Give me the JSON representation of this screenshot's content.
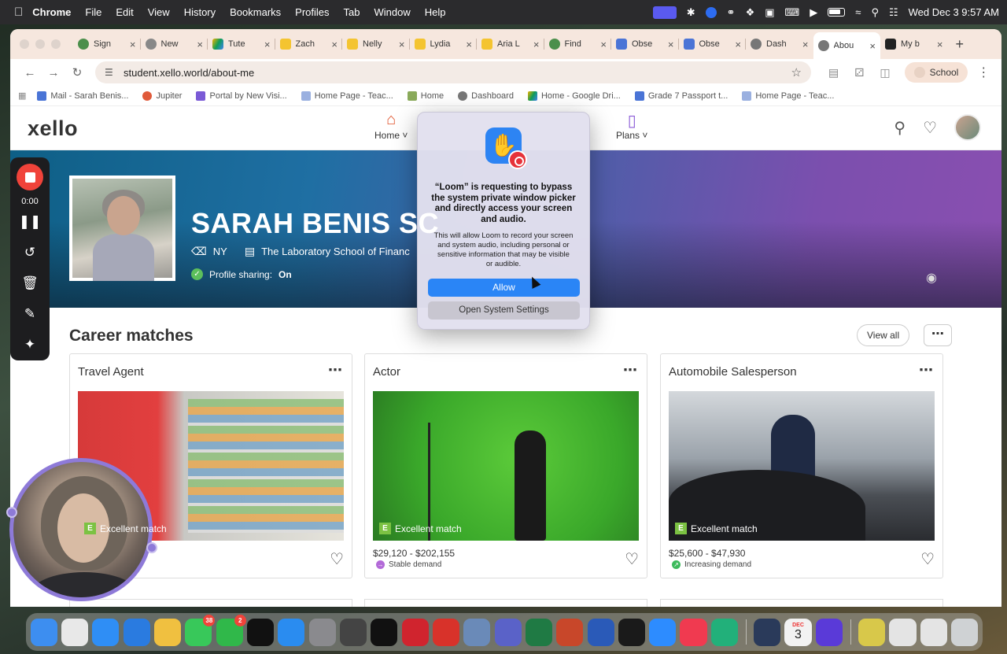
{
  "menubar": {
    "app": "Chrome",
    "items": [
      "File",
      "Edit",
      "View",
      "History",
      "Bookmarks",
      "Profiles",
      "Tab",
      "Window",
      "Help"
    ],
    "clock": "Wed Dec 3  9:57 AM"
  },
  "tabs": [
    {
      "label": "Sign",
      "color": "#4b8f4b"
    },
    {
      "label": "New",
      "color": "#666666"
    },
    {
      "label": "Tute",
      "color": "#f4b400"
    },
    {
      "label": "Zach",
      "color": "#f4c430"
    },
    {
      "label": "Nelly",
      "color": "#f4c430"
    },
    {
      "label": "Lydia",
      "color": "#f4c430"
    },
    {
      "label": "Aria L",
      "color": "#f4c430"
    },
    {
      "label": "Find",
      "color": "#4b8f4b"
    },
    {
      "label": "Obse",
      "color": "#4a74d6"
    },
    {
      "label": "Obse",
      "color": "#4a74d6"
    },
    {
      "label": "Dash",
      "color": "#777777"
    },
    {
      "label": "Abou",
      "color": "#777777",
      "active": true
    },
    {
      "label": "My b",
      "color": "#222222"
    }
  ],
  "toolbar": {
    "url": "student.xello.world/about-me",
    "profile_label": "School"
  },
  "bookmarks": [
    {
      "label": "Mail - Sarah Benis...",
      "color": "#4a74d6"
    },
    {
      "label": "Jupiter",
      "color": "#e05a3a"
    },
    {
      "label": "Portal by New Visi...",
      "color": "#7a5ad6"
    },
    {
      "label": "Home Page - Teac...",
      "color": "#9ab0e0"
    },
    {
      "label": "Home",
      "color": "#8aaa5a"
    },
    {
      "label": "Dashboard",
      "color": "#777777"
    },
    {
      "label": "Home - Google Dri...",
      "color": "#2aa85a"
    },
    {
      "label": "Grade 7 Passport t...",
      "color": "#4a74d6"
    },
    {
      "label": "Home Page - Teac...",
      "color": "#9ab0e0"
    }
  ],
  "xello": {
    "logo": "xello",
    "nav": [
      {
        "label": "Home",
        "icon": "house-icon"
      },
      {
        "label": "Plans",
        "icon": "clipboard-icon"
      }
    ],
    "profile": {
      "name": "SARAH BENIS SC",
      "state": "NY",
      "school": "The Laboratory School of Financ",
      "sharing_label": "Profile sharing:",
      "sharing_value": "On"
    },
    "career_section": {
      "title": "Career matches",
      "view_all": "View all",
      "cards": [
        {
          "title": "Travel Agent",
          "match": "Excellent match",
          "salary": "$",
          "demand": "",
          "demand_color": "#a56ad8"
        },
        {
          "title": "Actor",
          "match": "Excellent match",
          "salary": "$29,120 - $202,155",
          "demand": "Stable demand",
          "demand_color": "#b36ad8"
        },
        {
          "title": "Automobile Salesperson",
          "match": "Excellent match",
          "salary": "$25,600 - $47,930",
          "demand": "Increasing demand",
          "demand_color": "#3dba5c"
        }
      ]
    }
  },
  "loom": {
    "timer": "0:00"
  },
  "dialog": {
    "title": "“Loom” is requesting to bypass the system private window picker and directly access your screen and audio.",
    "body": "This will allow Loom to record your screen and system audio, including personal or sensitive information that may be visible or audible.",
    "allow_label": "Allow",
    "settings_label": "Open System Settings"
  },
  "dock": [
    {
      "name": "finder",
      "color": "#3d8ef0",
      "badge": ""
    },
    {
      "name": "chrome",
      "color": "#e8e8e8",
      "badge": ""
    },
    {
      "name": "safari",
      "color": "#2f8ef5",
      "badge": ""
    },
    {
      "name": "settings-snowflake",
      "color": "#2a7be0",
      "badge": ""
    },
    {
      "name": "photos",
      "color": "#f0c040",
      "badge": ""
    },
    {
      "name": "messages",
      "color": "#38c85a",
      "badge": "38"
    },
    {
      "name": "facetime",
      "color": "#30b84a",
      "badge": "2"
    },
    {
      "name": "tv",
      "color": "#111111",
      "badge": ""
    },
    {
      "name": "app-store",
      "color": "#2a8cf0",
      "badge": ""
    },
    {
      "name": "system-settings",
      "color": "#8a8a8e",
      "badge": ""
    },
    {
      "name": "pencil-app",
      "color": "#444444",
      "badge": ""
    },
    {
      "name": "paintbrush-app",
      "color": "#111111",
      "badge": ""
    },
    {
      "name": "creative-cloud",
      "color": "#d0242e",
      "badge": ""
    },
    {
      "name": "acrobat",
      "color": "#d8322a",
      "badge": ""
    },
    {
      "name": "preview",
      "color": "#6a8ab8",
      "badge": ""
    },
    {
      "name": "teams",
      "color": "#5a62c8",
      "badge": ""
    },
    {
      "name": "excel",
      "color": "#1f7a44",
      "badge": ""
    },
    {
      "name": "powerpoint",
      "color": "#c8472a",
      "badge": ""
    },
    {
      "name": "word",
      "color": "#2a5ab8",
      "badge": ""
    },
    {
      "name": "spotify",
      "color": "#1a1a1a",
      "badge": ""
    },
    {
      "name": "zoom",
      "color": "#2d8cff",
      "badge": ""
    },
    {
      "name": "music",
      "color": "#f03a50",
      "badge": ""
    },
    {
      "name": "pocket",
      "color": "#22b07a",
      "badge": ""
    },
    {
      "name": "quicktime",
      "color": "#2a3a5a",
      "badge": ""
    },
    {
      "name": "calendar",
      "color": "#f2f2f2",
      "badge": ""
    },
    {
      "name": "imovie-star",
      "color": "#5a3ad8",
      "badge": ""
    },
    {
      "name": "folder-stack",
      "color": "#d8c84a",
      "badge": ""
    },
    {
      "name": "screenshot-1",
      "color": "#e4e4e4",
      "badge": ""
    },
    {
      "name": "screenshot-2",
      "color": "#e4e4e4",
      "badge": ""
    },
    {
      "name": "trash",
      "color": "#cfd2d4",
      "badge": ""
    }
  ],
  "dock_calendar": {
    "month": "DEC",
    "day": "3"
  }
}
